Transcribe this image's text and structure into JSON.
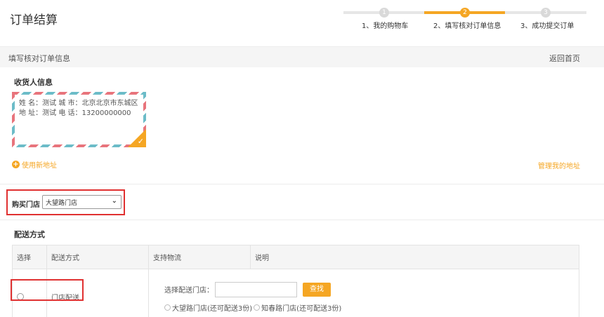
{
  "header": {
    "title": "订单结算"
  },
  "steps": [
    {
      "num": "1",
      "label": "1、我的购物车",
      "active": false
    },
    {
      "num": "2",
      "label": "2、填写核对订单信息",
      "active": true
    },
    {
      "num": "3",
      "label": "3、成功提交订单",
      "active": false
    }
  ],
  "section": {
    "title": "填写核对订单信息",
    "back_home": "返回首页"
  },
  "receiver": {
    "heading": "收货人信息",
    "line1": "姓 名：测试 城 市：北京北京市东城区",
    "line2": "地 址：测试 电 话：13200000000",
    "add_new": "使用新地址",
    "manage": "管理我的地址"
  },
  "store": {
    "label": "购买门店",
    "selected": "大望路门店"
  },
  "delivery": {
    "heading": "配送方式",
    "columns": [
      "选择",
      "配送方式",
      "支持物流",
      "说明"
    ],
    "row": {
      "method": "门店配送",
      "select_label": "选择配送门店：",
      "search_button": "查找",
      "option1": "大望路门店(还可配送3份)",
      "option2": "知春路门店(还可配送3份)"
    }
  },
  "colors": {
    "accent": "#f5a623",
    "highlight": "#e03131"
  }
}
